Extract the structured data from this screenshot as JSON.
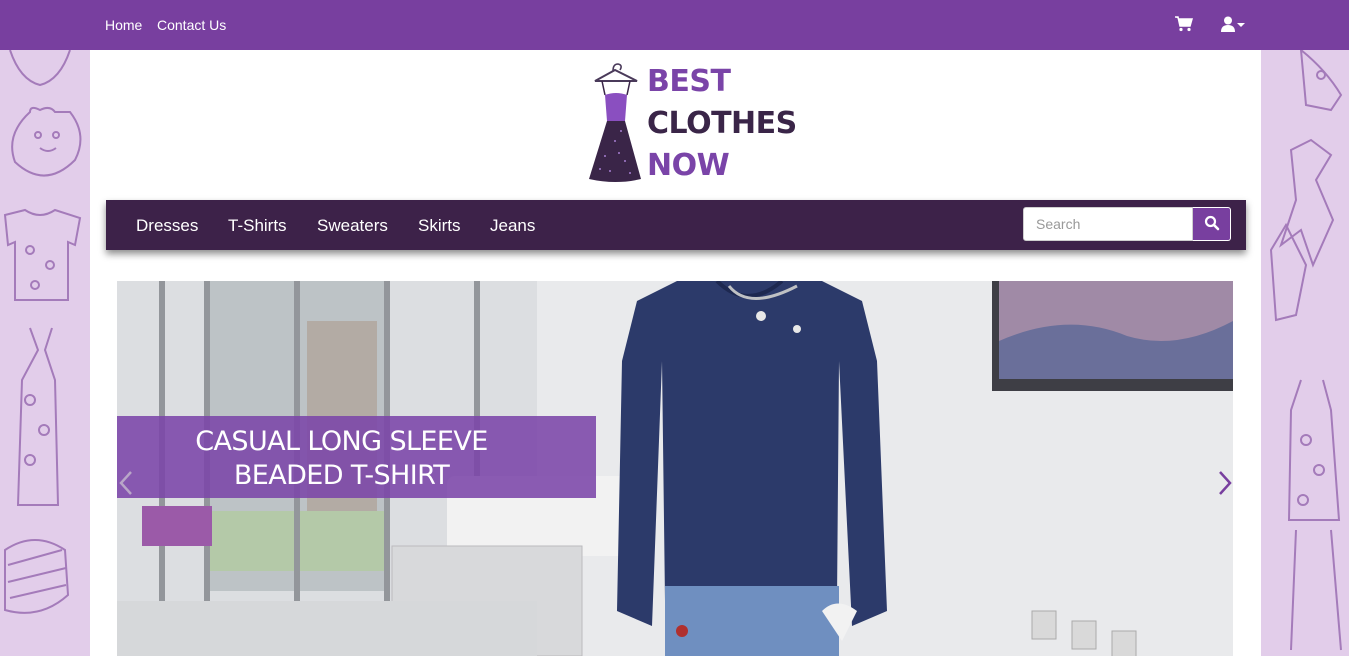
{
  "topbar": {
    "links": [
      "Home",
      "Contact Us"
    ],
    "icons": [
      "shopping-cart-icon",
      "user-icon",
      "caret-down-icon"
    ]
  },
  "brand": {
    "lines": [
      "BEST",
      "CLOTHES",
      "NOW"
    ],
    "line_colors": [
      "#7a44a8",
      "#3a2548",
      "#7a44a8"
    ],
    "logo_icon": "dress-on-hanger-icon"
  },
  "catnav": {
    "items": [
      "Dresses",
      "T-Shirts",
      "Sweaters",
      "Skirts",
      "Jeans"
    ]
  },
  "search": {
    "placeholder": "Search",
    "value": "",
    "icon": "search-icon"
  },
  "carousel": {
    "caption_lines": [
      "CASUAL LONG SLEEVE",
      "BEADED T-SHIRT"
    ],
    "prev_icon": "chevron-left-icon",
    "next_icon": "chevron-right-icon"
  },
  "colors": {
    "primary": "#783f9f",
    "nav_dark": "#3d2249",
    "side_background": "#e2cdea",
    "caption_bg": "#7b46a8"
  }
}
